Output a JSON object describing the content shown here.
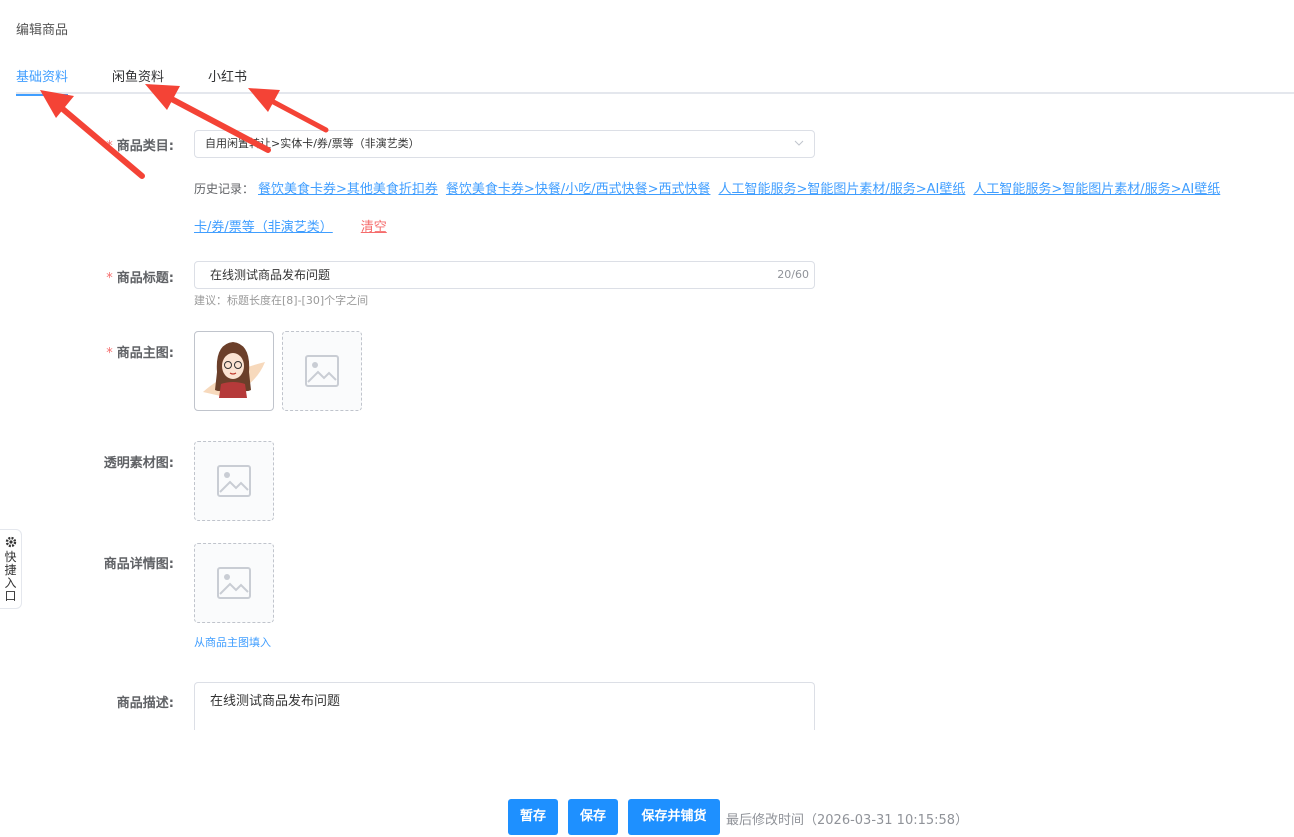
{
  "page": {
    "title": "编辑商品"
  },
  "tabs": [
    {
      "label": "基础资料",
      "active": true
    },
    {
      "label": "闲鱼资料",
      "active": false
    },
    {
      "label": "小红书",
      "active": false
    }
  ],
  "form": {
    "category": {
      "label": "商品类目:",
      "value": "自用闲置转让>实体卡/券/票等（非演艺类）",
      "history_label": "历史记录：",
      "history": [
        "餐饮美食卡券>其他美食折扣券",
        "餐饮美食卡券>快餐/小吃/西式快餐>西式快餐",
        "人工智能服务>智能图片素材/服务>AI壁纸",
        "人工智能服务>智能图片素材/服务>AI壁纸",
        "卡/券/票等（非演艺类）"
      ],
      "clear_label": "清空"
    },
    "title": {
      "label": "商品标题:",
      "value": "在线测试商品发布问题",
      "count": "20/60",
      "hint": "建议：标题长度在[8]-[30]个字之间"
    },
    "main_image": {
      "label": "商品主图:"
    },
    "transparent_image": {
      "label": "透明素材图:"
    },
    "detail_image": {
      "label": "商品详情图:",
      "fill_link": "从商品主图填入"
    },
    "description": {
      "label": "商品描述:",
      "value": "在线测试商品发布问题"
    }
  },
  "side_tab": {
    "icon": "gear-icon",
    "chars": [
      "快",
      "捷",
      "入",
      "口"
    ]
  },
  "footer": {
    "draft_label": "暂存",
    "save_label": "保存",
    "save_distribute_label": "保存并铺货",
    "last_modified": "最后修改时间（2026-03-31 10:15:58）"
  },
  "colors": {
    "accent": "#409eff",
    "button": "#1e90ff",
    "danger": "#f56c6c",
    "arrow": "#f44336"
  }
}
